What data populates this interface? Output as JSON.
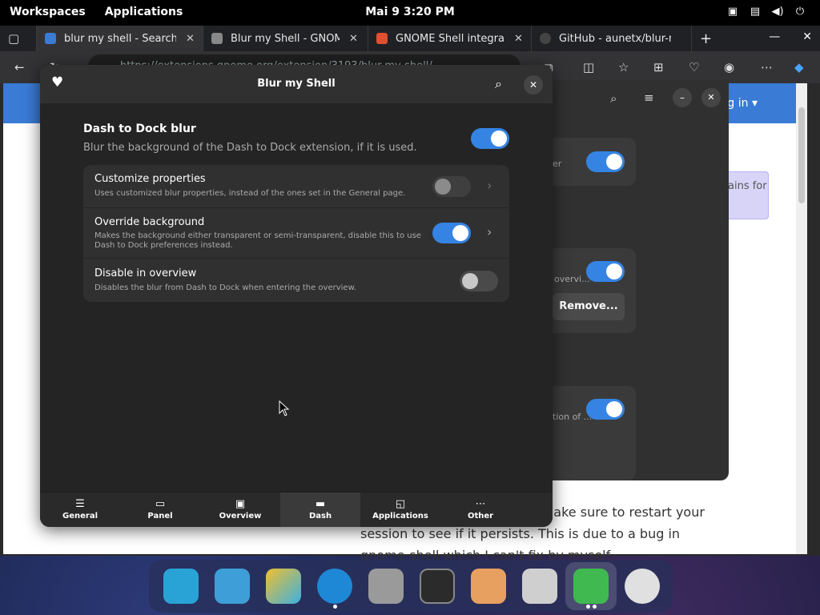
{
  "topbar": {
    "workspaces": "Workspaces",
    "applications": "Applications",
    "clock": "Mai 9   3:20 PM"
  },
  "browser": {
    "tabs": [
      {
        "title": "blur my shell - Search",
        "favicon_color": "#3a7bd5"
      },
      {
        "title": "Blur my Shell - GNOME",
        "favicon_color": "#888888"
      },
      {
        "title": "GNOME Shell integratio",
        "favicon_color": "#e05030"
      },
      {
        "title": "GitHub - aunetx/blur-m",
        "favicon_color": "#444444"
      }
    ],
    "address": "https://extensions.gnome.org/extension/3193/blur-my-shell/",
    "login": "Log in",
    "notice": "ains for",
    "page_text": "error after updating, please make sure to restart your session to see if it persists. This is due to a bug in gnome-shell which I can't fix by myself."
  },
  "bgwindow": {
    "row1_text": "er",
    "row2_text": "overvi...",
    "row3_text": "tion of ...",
    "remove_label": "Remove..."
  },
  "dialog": {
    "title": "Blur my Shell",
    "section_title": "Dash to Dock blur",
    "section_desc": "Blur the background of the Dash to Dock extension, if it is used.",
    "main_toggle_on": true,
    "rows": [
      {
        "title": "Customize properties",
        "desc": "Uses customized blur properties, instead of the ones set in the General page.",
        "on": false
      },
      {
        "title": "Override background",
        "desc": "Makes the background either transparent or semi-transparent, disable this to use Dash to Dock preferences instead.",
        "on": true
      },
      {
        "title": "Disable in overview",
        "desc": "Disables the blur from Dash to Dock when entering the overview.",
        "on": false
      }
    ],
    "nav": [
      {
        "label": "General",
        "icon": "sliders-icon"
      },
      {
        "label": "Panel",
        "icon": "panel-icon"
      },
      {
        "label": "Overview",
        "icon": "overview-icon"
      },
      {
        "label": "Dash",
        "icon": "dash-icon",
        "active": true
      },
      {
        "label": "Applications",
        "icon": "applications-icon"
      },
      {
        "label": "Other",
        "icon": "more-icon"
      }
    ]
  },
  "dock": {
    "items": [
      {
        "name": "search-app",
        "color": "#29a3d6"
      },
      {
        "name": "files-app",
        "color": "#3e9fd8"
      },
      {
        "name": "app-grid",
        "color": "#f0c030"
      },
      {
        "name": "edge-browser",
        "color": "#1e88d6"
      },
      {
        "name": "file-manager",
        "color": "#9a9a9a"
      },
      {
        "name": "terminal",
        "color": "#2b2b2b"
      },
      {
        "name": "launcher-rocket",
        "color": "#e8a060"
      },
      {
        "name": "settings",
        "color": "#cfcfcf"
      },
      {
        "name": "extensions",
        "color": "#3fb950"
      },
      {
        "name": "disc",
        "color": "#e0e0e0"
      }
    ]
  }
}
